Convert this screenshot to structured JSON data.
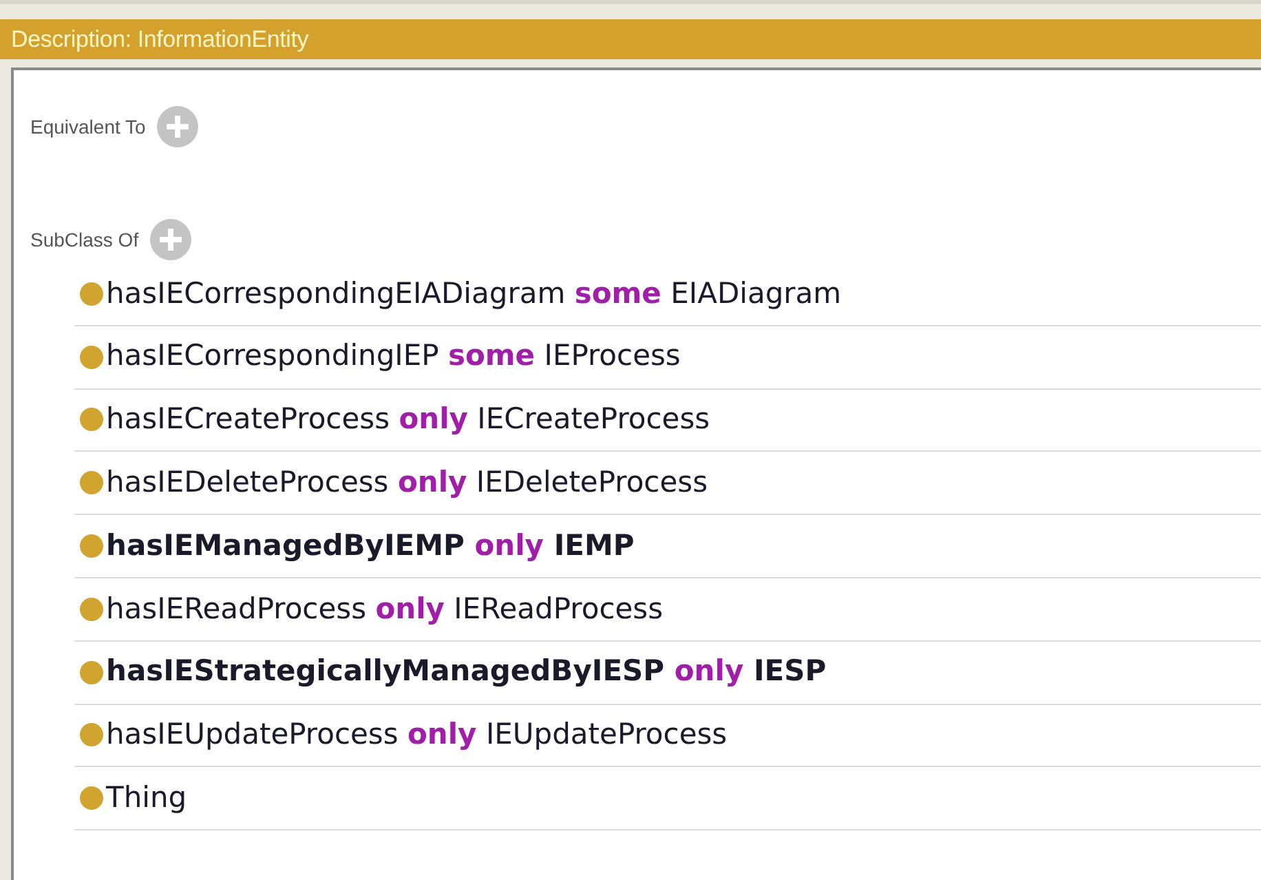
{
  "header": {
    "title": "Description: InformationEntity"
  },
  "sections": [
    {
      "title": "Equivalent To"
    },
    {
      "title": "SubClass Of",
      "rows": [
        {
          "bold": false,
          "segments": [
            {
              "kind": "entity",
              "text": "hasIECorrespondingEIADiagram"
            },
            {
              "kind": "keyword",
              "text": "some"
            },
            {
              "kind": "entity",
              "text": "EIADiagram"
            }
          ]
        },
        {
          "bold": false,
          "segments": [
            {
              "kind": "entity",
              "text": "hasIECorrespondingIEP"
            },
            {
              "kind": "keyword",
              "text": "some"
            },
            {
              "kind": "entity",
              "text": "IEProcess"
            }
          ]
        },
        {
          "bold": false,
          "segments": [
            {
              "kind": "entity",
              "text": "hasIECreateProcess"
            },
            {
              "kind": "keyword",
              "text": "only"
            },
            {
              "kind": "entity",
              "text": "IECreateProcess"
            }
          ]
        },
        {
          "bold": false,
          "segments": [
            {
              "kind": "entity",
              "text": "hasIEDeleteProcess"
            },
            {
              "kind": "keyword",
              "text": "only"
            },
            {
              "kind": "entity",
              "text": "IEDeleteProcess"
            }
          ]
        },
        {
          "bold": true,
          "segments": [
            {
              "kind": "entity",
              "text": "hasIEManagedByIEMP"
            },
            {
              "kind": "keyword",
              "text": "only"
            },
            {
              "kind": "entity",
              "text": "IEMP"
            }
          ]
        },
        {
          "bold": false,
          "segments": [
            {
              "kind": "entity",
              "text": "hasIEReadProcess"
            },
            {
              "kind": "keyword",
              "text": "only"
            },
            {
              "kind": "entity",
              "text": "IEReadProcess"
            }
          ]
        },
        {
          "bold": true,
          "segments": [
            {
              "kind": "entity",
              "text": "hasIEStrategicallyManagedByIESP"
            },
            {
              "kind": "keyword",
              "text": "only"
            },
            {
              "kind": "entity",
              "text": "IESP"
            }
          ]
        },
        {
          "bold": false,
          "segments": [
            {
              "kind": "entity",
              "text": "hasIEUpdateProcess"
            },
            {
              "kind": "keyword",
              "text": "only"
            },
            {
              "kind": "entity",
              "text": "IEUpdateProcess"
            }
          ]
        },
        {
          "bold": false,
          "segments": [
            {
              "kind": "entity",
              "text": "Thing"
            }
          ]
        }
      ]
    }
  ]
}
